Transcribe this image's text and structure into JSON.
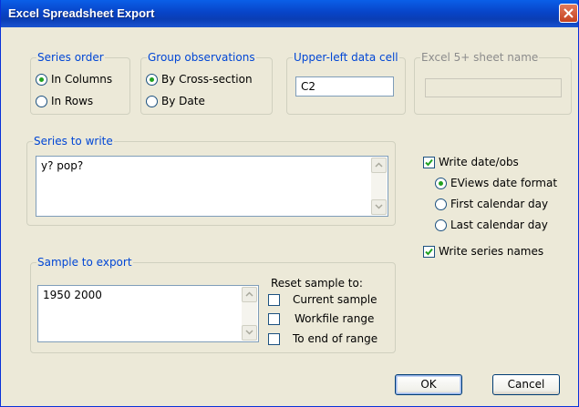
{
  "window": {
    "title": "Excel Spreadsheet Export"
  },
  "series_order": {
    "legend": "Series order",
    "options": [
      "In Columns",
      "In Rows"
    ],
    "selected": "In Columns"
  },
  "group_observations": {
    "legend": "Group observations",
    "options": [
      "By Cross-section",
      "By Date"
    ],
    "selected": "By Cross-section"
  },
  "upper_left": {
    "legend": "Upper-left data cell",
    "value": "C2"
  },
  "excel5_sheet": {
    "legend": "Excel 5+ sheet name",
    "value": ""
  },
  "series_to_write": {
    "legend": "Series to write",
    "value": "y? pop?"
  },
  "sample_to_export": {
    "legend": "Sample to export",
    "value": "1950 2000"
  },
  "reset_sample": {
    "label": "Reset sample to:",
    "options": [
      "Current sample",
      "Workfile range",
      "To end of range"
    ]
  },
  "write_date_obs": {
    "label": "Write date/obs",
    "checked": true,
    "options": [
      "EViews date format",
      "First calendar day",
      "Last calendar day"
    ],
    "selected": "EViews date format"
  },
  "write_series_names": {
    "label": "Write series names",
    "checked": true
  },
  "buttons": {
    "ok": "OK",
    "cancel": "Cancel"
  },
  "colors": {
    "title_bar": "#0a4fd8",
    "legend_text": "#0046d5",
    "face": "#ece9d8",
    "radio_dot": "#21a121",
    "check_mark": "#21a121"
  },
  "icons": {
    "close": "close-icon",
    "checkmark": "checkmark-icon",
    "scroll_up": "chevron-up-icon",
    "scroll_down": "chevron-down-icon"
  }
}
